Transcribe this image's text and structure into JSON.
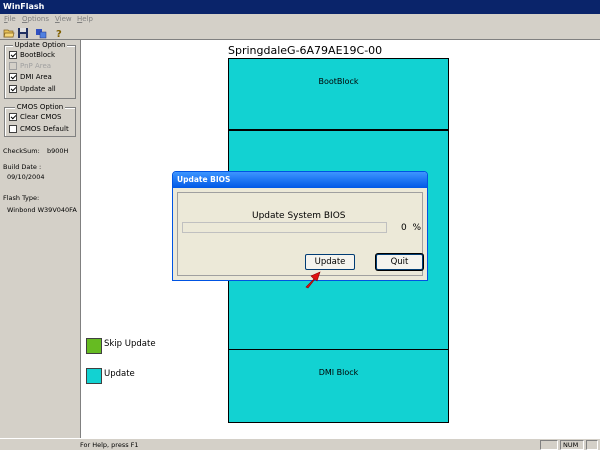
{
  "window": {
    "title": "WinFlash"
  },
  "menu": [
    {
      "label": "File",
      "underline": "F",
      "rest": "ile"
    },
    {
      "label": "Options",
      "underline": "O",
      "rest": "ptions"
    },
    {
      "label": "View",
      "underline": "V",
      "rest": "iew"
    },
    {
      "label": "Help",
      "underline": "H",
      "rest": "elp"
    }
  ],
  "toolbar": {
    "icons": [
      "open-folder-icon",
      "save-disk-icon",
      "flash-chip-icon",
      "help-question-icon"
    ]
  },
  "left_panel": {
    "update_option": {
      "title": "Update Option",
      "items": [
        {
          "label": "BootBlock",
          "checked": true,
          "enabled": true
        },
        {
          "label": "PnP Area",
          "checked": false,
          "enabled": false
        },
        {
          "label": "DMI Area",
          "checked": true,
          "enabled": true
        },
        {
          "label": "Update all",
          "checked": true,
          "enabled": true
        }
      ]
    },
    "cmos_option": {
      "title": "CMOS Option",
      "items": [
        {
          "label": "Clear CMOS",
          "checked": true,
          "enabled": true
        },
        {
          "label": "CMOS Default",
          "checked": false,
          "enabled": true
        }
      ]
    },
    "checksum": {
      "label": "CheckSum:",
      "value": "b900H"
    },
    "build_date": {
      "label": "Build Date :",
      "value": "09/10/2004"
    },
    "flash_type": {
      "label": "Flash Type:",
      "value": "Winbond W39V040FA"
    }
  },
  "main": {
    "chip_title": "SpringdaleG-6A79AE19C-00",
    "blocks": [
      {
        "label": "BootBlock"
      },
      {
        "label": ""
      },
      {
        "label": "DMI Block"
      }
    ],
    "legend": [
      {
        "label": "Skip Update",
        "color": "#66bb22"
      },
      {
        "label": "Update",
        "color": "#12d2d2"
      }
    ]
  },
  "dialog": {
    "title": "Update BIOS",
    "message": "Update System BIOS",
    "progress": 0,
    "percent_value": "0",
    "percent_sign": "%",
    "update_button": "Update",
    "quit_button": "Quit"
  },
  "statusbar": {
    "help_text": "For Help, press F1",
    "indicator": "NUM"
  }
}
